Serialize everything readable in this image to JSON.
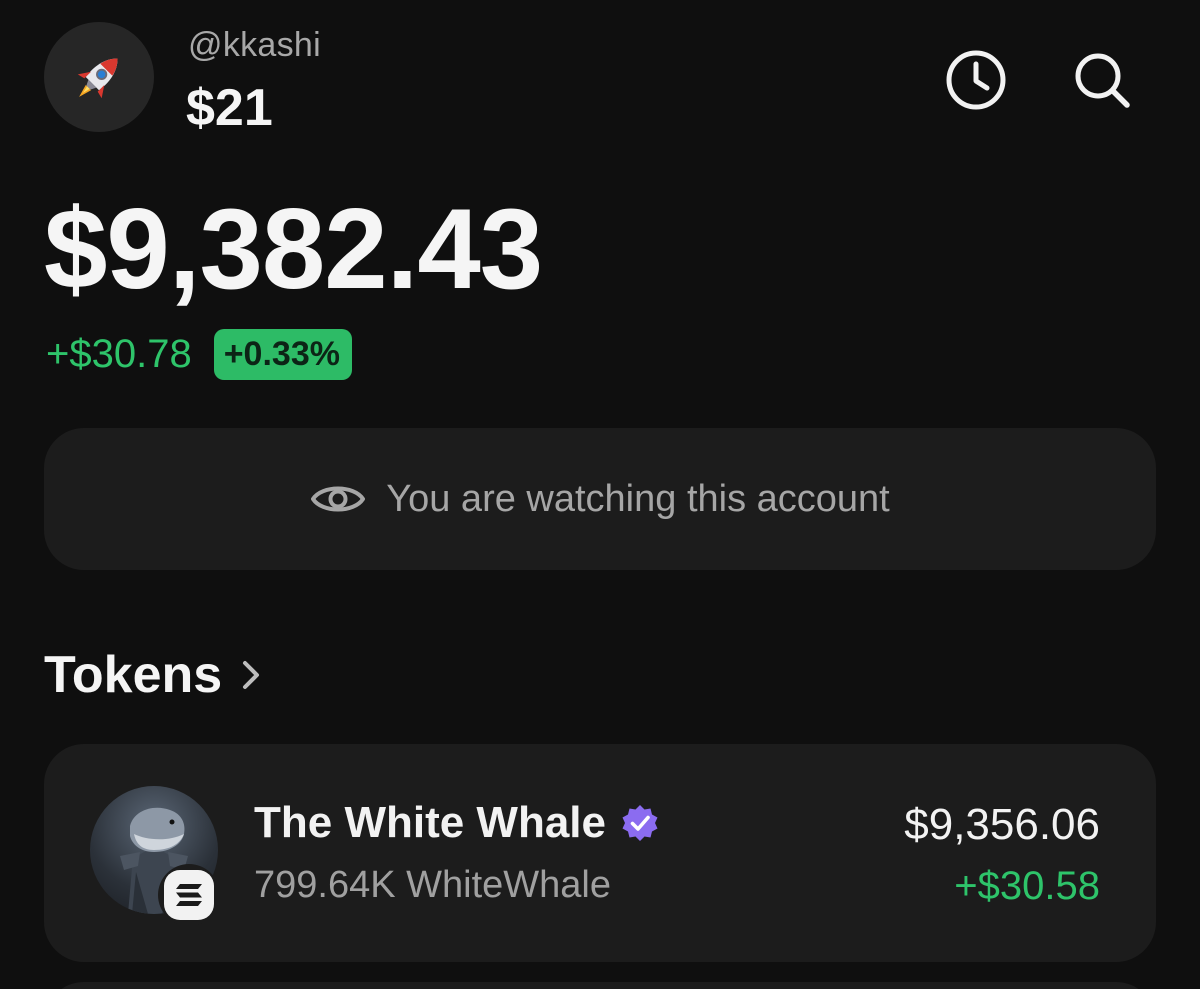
{
  "account": {
    "handle": "@kkashi",
    "small_balance": "$21",
    "avatar_icon": "rocket-icon"
  },
  "header": {
    "history_icon": "clock-icon",
    "search_icon": "search-icon"
  },
  "portfolio": {
    "total_balance": "$9,382.43",
    "change_amount": "+$30.78",
    "change_percent": "+0.33%"
  },
  "watch_banner": {
    "icon": "eye-icon",
    "text": "You are watching this account"
  },
  "tokens": {
    "title": "Tokens",
    "items": [
      {
        "name": "The White Whale",
        "verified": true,
        "amount": "799.64K WhiteWhale",
        "value": "$9,356.06",
        "change": "+$30.58",
        "chain_icon": "solana-icon"
      }
    ]
  },
  "colors": {
    "background": "#0f0f0f",
    "card": "#1c1c1c",
    "positive": "#2ec46a",
    "verified": "#8b6cf0"
  }
}
